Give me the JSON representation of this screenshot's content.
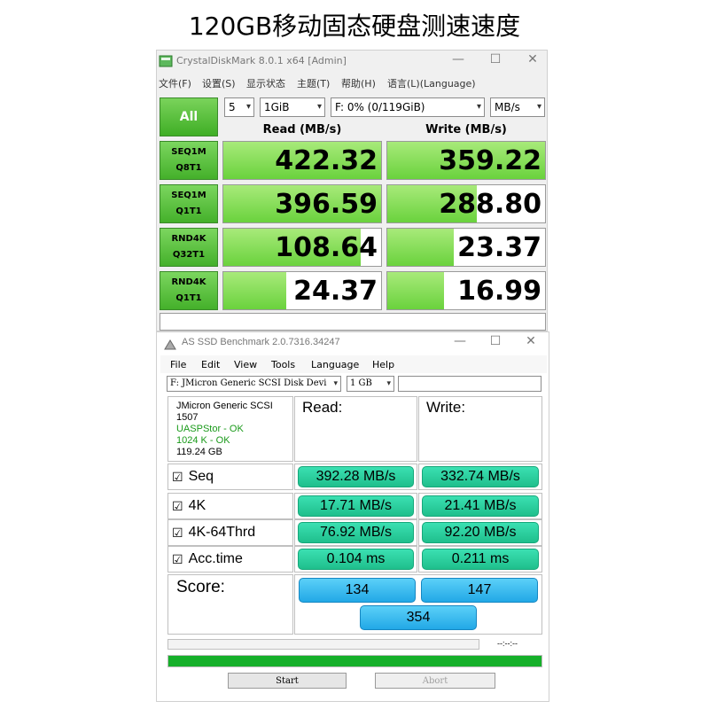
{
  "headline": "120GB移动固态硬盘测速速度",
  "cdm": {
    "title": "CrystalDiskMark 8.0.1 x64 [Admin]",
    "menu": [
      "文件(F)",
      "设置(S)",
      "显示状态",
      "主题(T)",
      "帮助(H)",
      "语言(L)(Language)"
    ],
    "all_label": "All",
    "count": "5",
    "size": "1GiB",
    "drive": "F: 0% (0/119GiB)",
    "unit": "MB/s",
    "read_header": "Read (MB/s)",
    "write_header": "Write (MB/s)",
    "rows": [
      {
        "line1": "SEQ1M",
        "line2": "Q8T1",
        "read": "422.32",
        "write": "359.22",
        "read_fill": 1.0,
        "write_fill": 1.0
      },
      {
        "line1": "SEQ1M",
        "line2": "Q1T1",
        "read": "396.59",
        "write": "288.80",
        "read_fill": 1.0,
        "write_fill": 0.57
      },
      {
        "line1": "RND4K",
        "line2": "Q32T1",
        "read": "108.64",
        "write": "23.37",
        "read_fill": 0.87,
        "write_fill": 0.42
      },
      {
        "line1": "RND4K",
        "line2": "Q1T1",
        "read": "24.37",
        "write": "16.99",
        "read_fill": 0.4,
        "write_fill": 0.36
      }
    ],
    "comment": ""
  },
  "asssd": {
    "title": "AS SSD Benchmark 2.0.7316.34247",
    "menu": [
      "File",
      "Edit",
      "View",
      "Tools",
      "Language",
      "Help"
    ],
    "drive": "F: JMicron Generic SCSI Disk Devi",
    "size": "1 GB",
    "info": {
      "model": "JMicron Generic SCSI",
      "fw": "1507",
      "driver": "UASPStor - OK",
      "align": "1024 K - OK",
      "capacity": "119.24 GB"
    },
    "read_header": "Read:",
    "write_header": "Write:",
    "rows": [
      {
        "label": "Seq",
        "read": "392.28 MB/s",
        "write": "332.74 MB/s"
      },
      {
        "label": "4K",
        "read": "17.71 MB/s",
        "write": "21.41 MB/s"
      },
      {
        "label": "4K-64Thrd",
        "read": "76.92 MB/s",
        "write": "92.20 MB/s"
      },
      {
        "label": "Acc.time",
        "read": "0.104 ms",
        "write": "0.211 ms"
      }
    ],
    "score_label": "Score:",
    "score_read": "134",
    "score_write": "147",
    "score_total": "354",
    "time": "--:--:--",
    "progress": 1.0,
    "start_label": "Start",
    "abort_label": "Abort"
  },
  "colors": {
    "cdm_green": "#6ad23d",
    "as_green": "#1fbf8c",
    "as_blue": "#22a8e6",
    "progress": "#16b02a"
  }
}
